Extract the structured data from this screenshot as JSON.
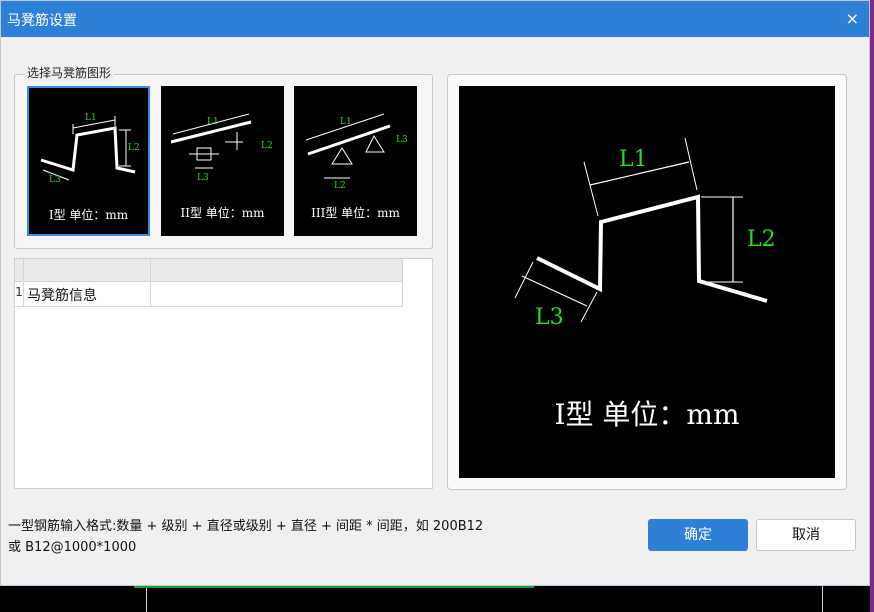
{
  "window": {
    "title": "马凳筋设置",
    "close_glyph": "×"
  },
  "shape_group": {
    "label": "选择马凳筋图形",
    "options": [
      {
        "label": "I型 单位：mm",
        "selected": true,
        "dims": [
          "L1",
          "L2",
          "L3"
        ]
      },
      {
        "label": "II型 单位：mm",
        "selected": false,
        "dims": [
          "L1",
          "L2",
          "L3"
        ]
      },
      {
        "label": "III型 单位：mm",
        "selected": false,
        "dims": [
          "L1",
          "L2",
          "L3"
        ]
      }
    ]
  },
  "table": {
    "headers": [
      "",
      "",
      ""
    ],
    "rows": [
      {
        "num": "1",
        "label": "马凳筋信息",
        "value": ""
      }
    ]
  },
  "preview": {
    "label": "I型 单位：mm",
    "dims": [
      "L1",
      "L2",
      "L3"
    ]
  },
  "hint": {
    "line1": "一型钢筋输入格式:数量 + 级别 + 直径或级别 + 直径 + 间距 * 间距，如 200B12",
    "line2": "或 B12@1000*1000"
  },
  "buttons": {
    "ok": "确定",
    "cancel": "取消"
  },
  "colors": {
    "accent": "#2d80d6",
    "dim_text": "#22dd22"
  }
}
